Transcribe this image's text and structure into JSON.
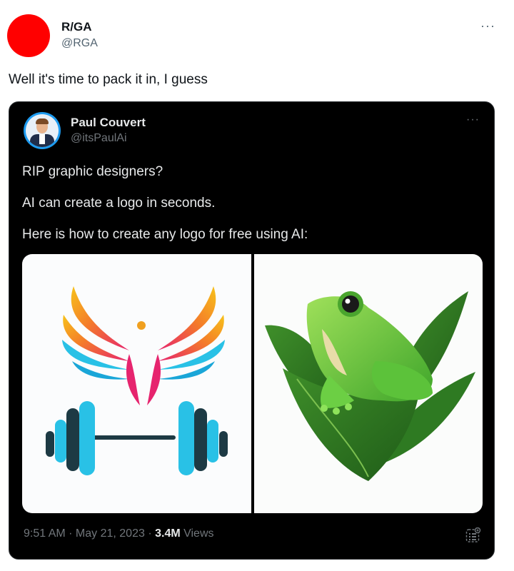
{
  "outer_tweet": {
    "display_name": "R/GA",
    "handle": "@RGA",
    "more_label": "···",
    "text": "Well it's time to pack it in, I guess",
    "avatar_color": "#ff0000"
  },
  "quoted_tweet": {
    "display_name": "Paul Couvert",
    "handle": "@itsPaulAi",
    "more_label": "···",
    "lines": [
      "RIP graphic designers?",
      "AI can create a logo in seconds.",
      "Here is how to create any logo for free using AI:"
    ],
    "timestamp": "9:51 AM · May 21, 2023 · ",
    "views_count": "3.4M",
    "views_label": " Views",
    "media": [
      {
        "name": "fitness-wings-logo",
        "icon": "wings-dumbbell-logo"
      },
      {
        "name": "frog-leaf-logo",
        "icon": "frog-on-leaf-logo"
      }
    ]
  },
  "colors": {
    "card_bg": "#000000",
    "accent_blue": "#1d9bf0",
    "muted_text": "#71767b"
  }
}
